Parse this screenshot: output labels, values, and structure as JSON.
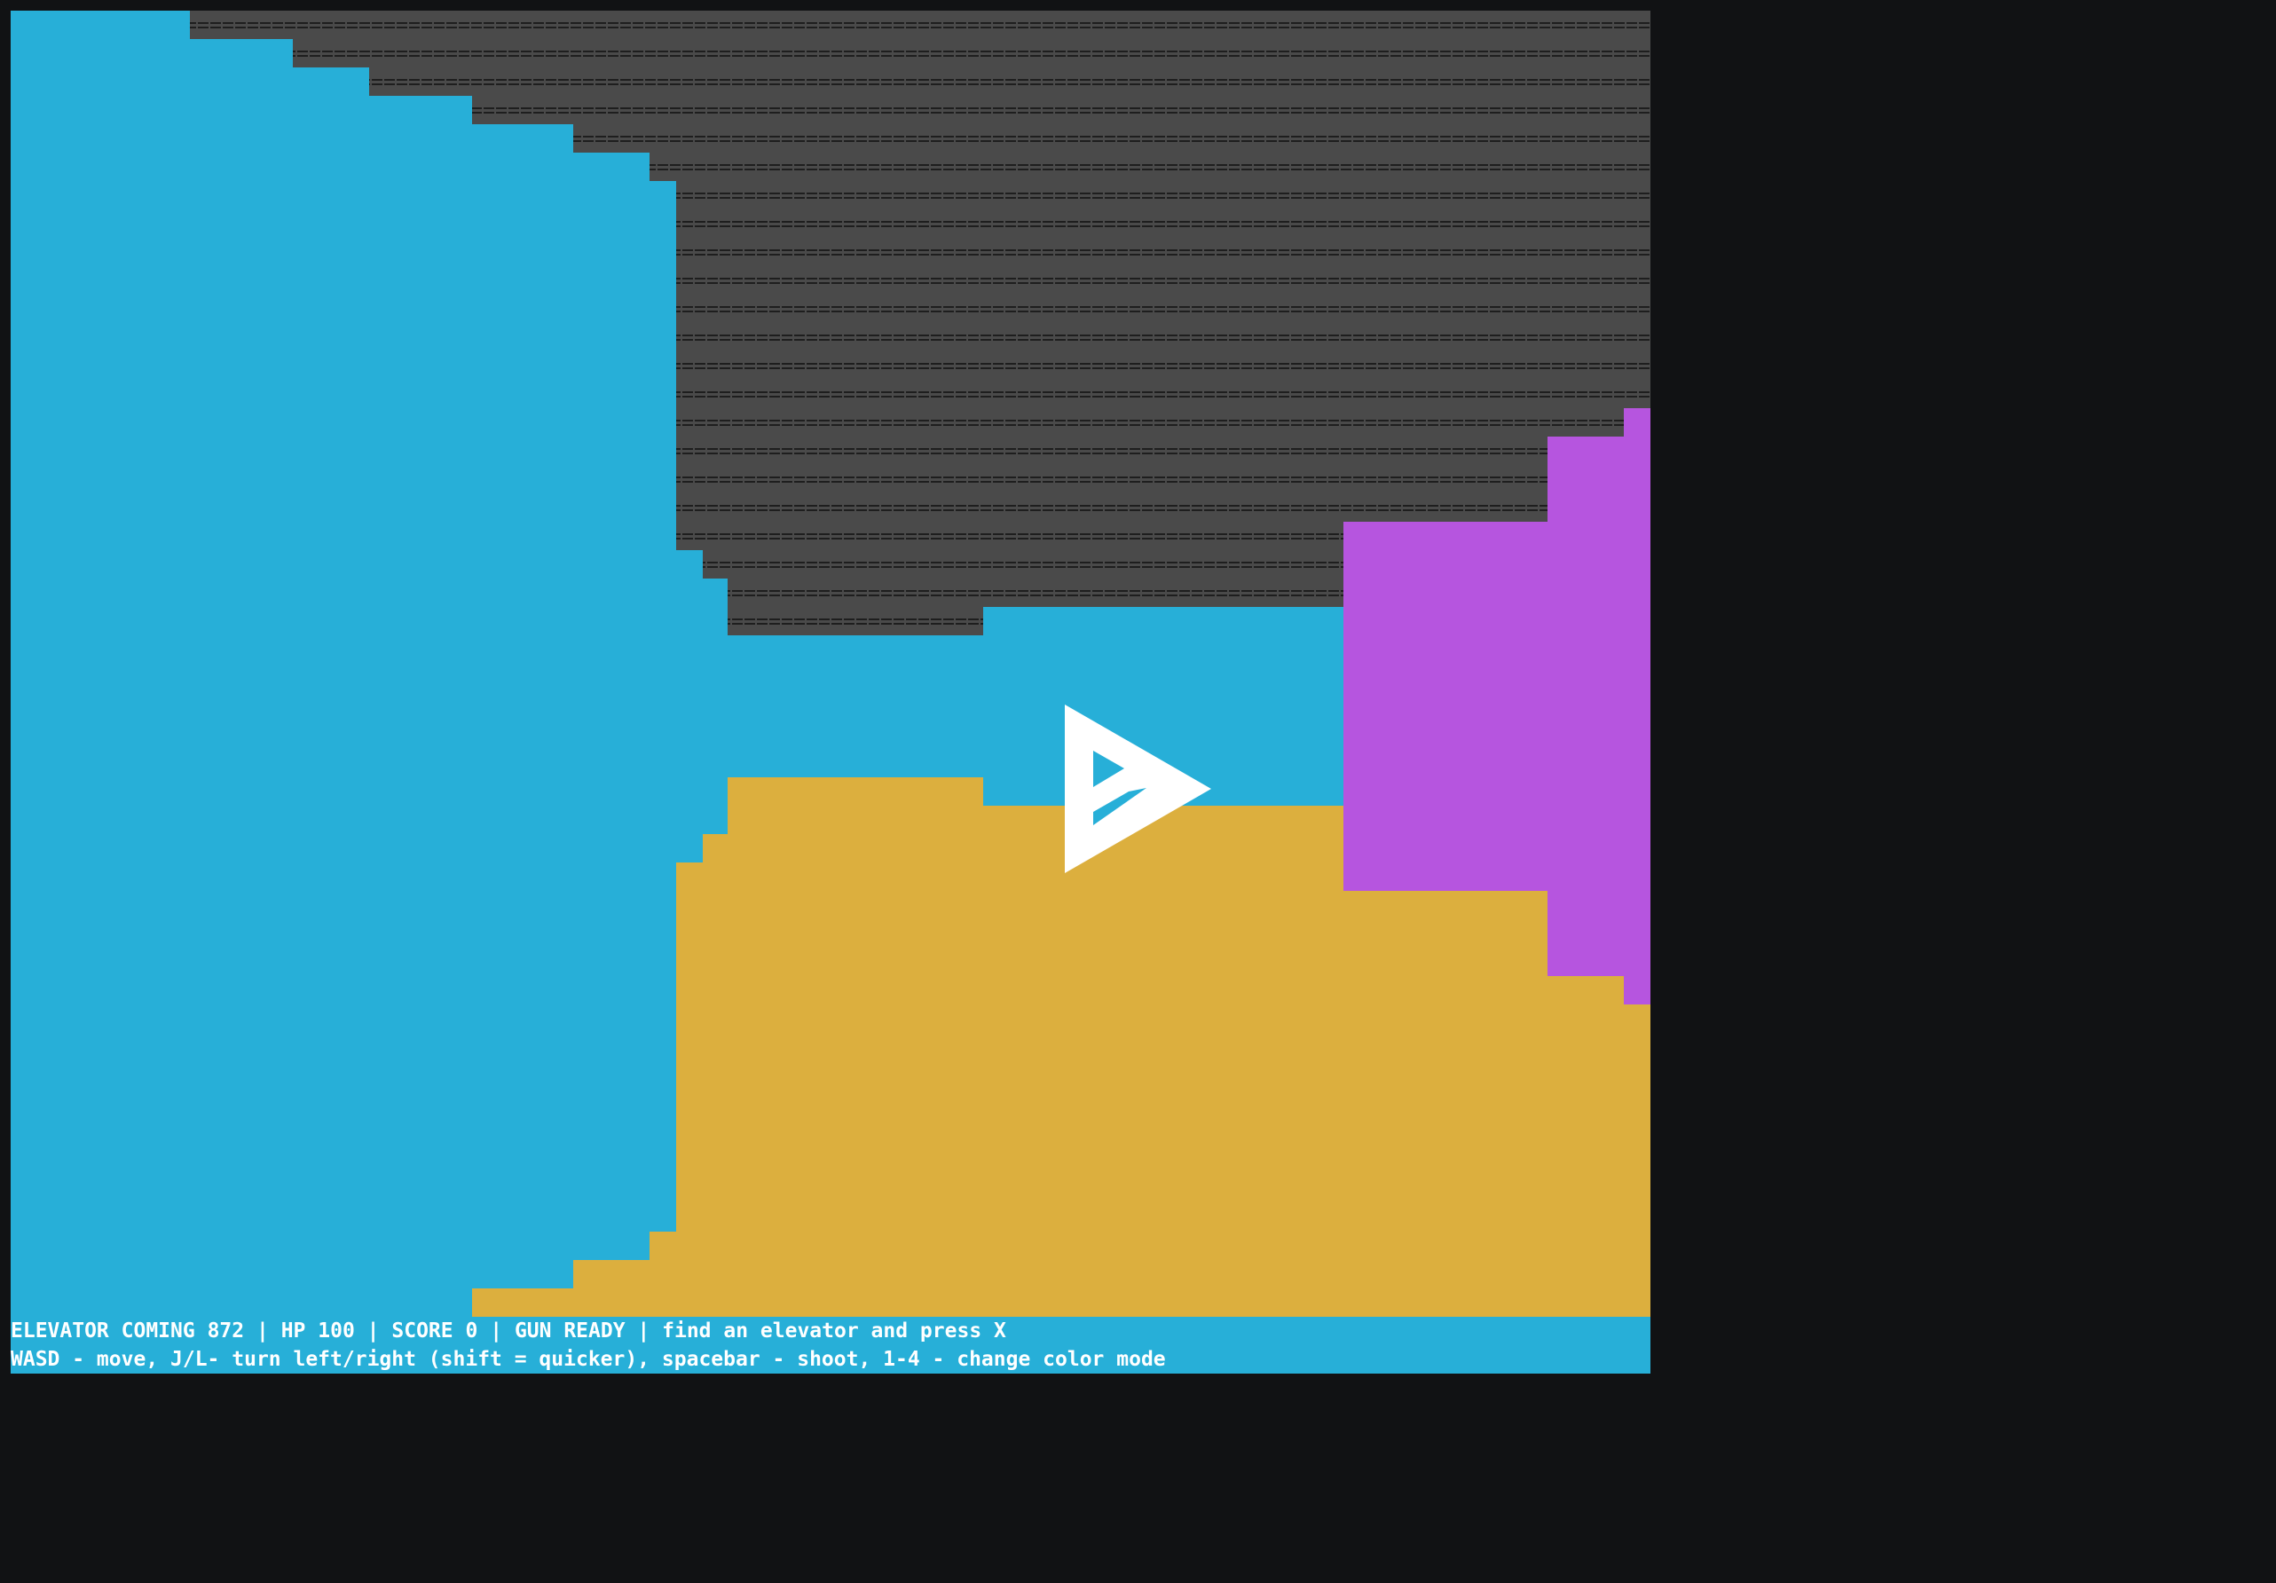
{
  "colors": {
    "background": "#111214",
    "ceiling": "#4a4a4a",
    "ceiling_pattern": "#1e1e1e",
    "wall_blue": "#27afd8",
    "floor_gold": "#dcaf3e",
    "wall_magenta": "#b655df",
    "player": "#ffffff",
    "hud_bg": "#27afd8",
    "hud_text": "#ffffff"
  },
  "scene": {
    "player_icon": "player-arrow-icon",
    "ceiling_glyph": "="
  },
  "hud": {
    "elevator_label": "ELEVATOR COMING",
    "elevator_value": "872",
    "hp_label": "HP",
    "hp_value": "100",
    "score_label": "SCORE",
    "score_value": "0",
    "gun_status": "GUN READY",
    "objective": "find an elevator and press X",
    "separator": "|",
    "help": "WASD - move, J/L- turn left/right (shift = quicker), spacebar - shoot, 1-4 - change color mode"
  }
}
